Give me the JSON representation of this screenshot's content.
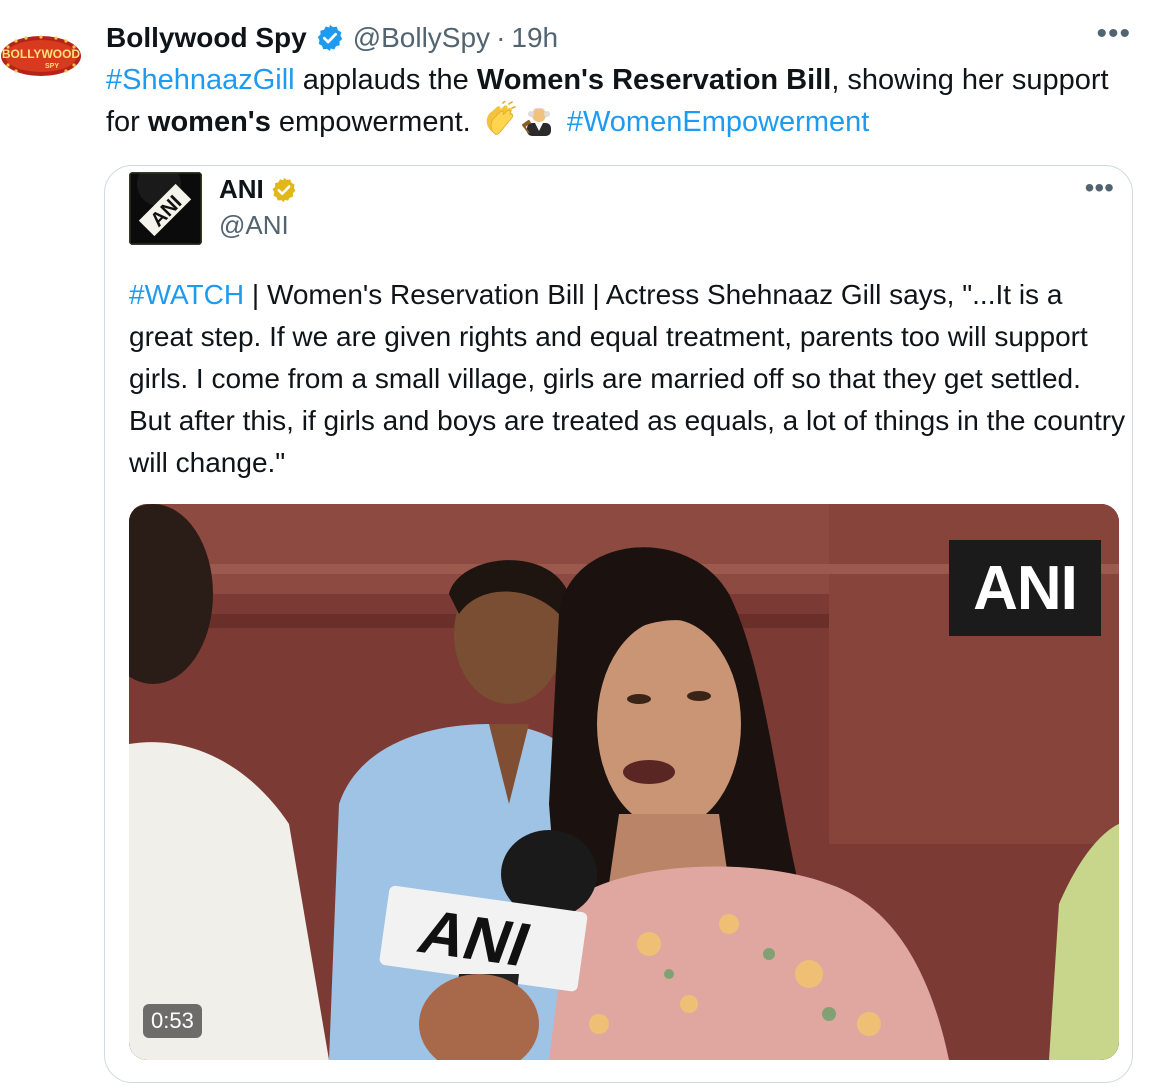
{
  "tweet": {
    "author_name": "Bollywood Spy",
    "handle": "@BollySpy",
    "separator": "·",
    "time": "19h",
    "more_label": "•••",
    "avatar_text": "BOLLYWOOD",
    "avatar_subtext": "SPY",
    "text": {
      "hashtag1": "#ShehnaazGill",
      "part1": " applauds the ",
      "bold1": "Women's Reservation Bill",
      "part2": ", showing her support for ",
      "bold2": "women's",
      "part3": " empowerment. ",
      "hashtag2": "#WomenEmpowerment"
    },
    "emojis": [
      "clapping-hands",
      "judge"
    ]
  },
  "quote": {
    "author_name": "ANI",
    "handle": "@ANI",
    "more_label": "•••",
    "avatar_text": "ANI",
    "hashtag": "#WATCH",
    "text": " | Women's Reservation Bill | Actress Shehnaaz Gill says, \"...It is a great step. If we are given rights and equal treatment, parents too will support girls. I come from a small village, girls are married off so that they get settled. But after this, if girls and boys are treated as equals, a lot of things in the country will change.\"",
    "video": {
      "watermark": "ANI",
      "mic_label": "ANI",
      "duration": "0:53"
    }
  },
  "colors": {
    "link": "#1d9bf0",
    "verified_blue": "#1d9bf0",
    "verified_gold": "#e2b719",
    "secondary_text": "#536471",
    "border": "#cfd9de"
  }
}
